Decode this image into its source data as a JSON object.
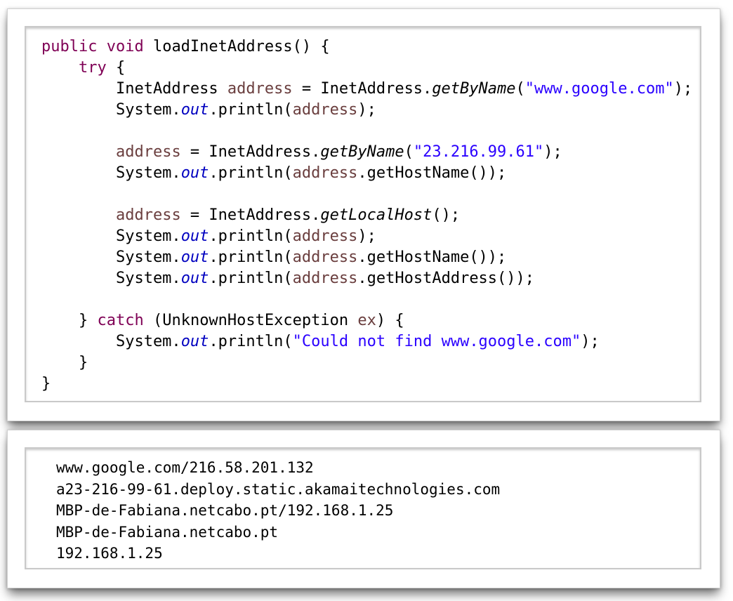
{
  "code_view": {
    "lines": [
      [
        {
          "t": "public void",
          "c": "kw"
        },
        {
          "t": " loadInetAddress() {",
          "c": "plain"
        }
      ],
      [
        {
          "t": "    ",
          "c": "plain"
        },
        {
          "t": "try",
          "c": "kw"
        },
        {
          "t": " {",
          "c": "plain"
        }
      ],
      [
        {
          "t": "        InetAddress ",
          "c": "plain"
        },
        {
          "t": "address",
          "c": "var"
        },
        {
          "t": " = InetAddress.",
          "c": "plain"
        },
        {
          "t": "getByName",
          "c": "static"
        },
        {
          "t": "(",
          "c": "plain"
        },
        {
          "t": "\"www.google.com\"",
          "c": "str"
        },
        {
          "t": ");",
          "c": "plain"
        }
      ],
      [
        {
          "t": "        System.",
          "c": "plain"
        },
        {
          "t": "out",
          "c": "field"
        },
        {
          "t": ".println(",
          "c": "plain"
        },
        {
          "t": "address",
          "c": "var"
        },
        {
          "t": ");",
          "c": "plain"
        }
      ],
      [],
      [
        {
          "t": "        ",
          "c": "plain"
        },
        {
          "t": "address",
          "c": "var"
        },
        {
          "t": " = InetAddress.",
          "c": "plain"
        },
        {
          "t": "getByName",
          "c": "static"
        },
        {
          "t": "(",
          "c": "plain"
        },
        {
          "t": "\"23.216.99.61\"",
          "c": "str"
        },
        {
          "t": ");",
          "c": "plain"
        }
      ],
      [
        {
          "t": "        System.",
          "c": "plain"
        },
        {
          "t": "out",
          "c": "field"
        },
        {
          "t": ".println(",
          "c": "plain"
        },
        {
          "t": "address",
          "c": "var"
        },
        {
          "t": ".getHostName());",
          "c": "plain"
        }
      ],
      [],
      [
        {
          "t": "        ",
          "c": "plain"
        },
        {
          "t": "address",
          "c": "var"
        },
        {
          "t": " = InetAddress.",
          "c": "plain"
        },
        {
          "t": "getLocalHost",
          "c": "static"
        },
        {
          "t": "();",
          "c": "plain"
        }
      ],
      [
        {
          "t": "        System.",
          "c": "plain"
        },
        {
          "t": "out",
          "c": "field"
        },
        {
          "t": ".println(",
          "c": "plain"
        },
        {
          "t": "address",
          "c": "var"
        },
        {
          "t": ");",
          "c": "plain"
        }
      ],
      [
        {
          "t": "        System.",
          "c": "plain"
        },
        {
          "t": "out",
          "c": "field"
        },
        {
          "t": ".println(",
          "c": "plain"
        },
        {
          "t": "address",
          "c": "var"
        },
        {
          "t": ".getHostName());",
          "c": "plain"
        }
      ],
      [
        {
          "t": "        System.",
          "c": "plain"
        },
        {
          "t": "out",
          "c": "field"
        },
        {
          "t": ".println(",
          "c": "plain"
        },
        {
          "t": "address",
          "c": "var"
        },
        {
          "t": ".getHostAddress());",
          "c": "plain"
        }
      ],
      [],
      [
        {
          "t": "    } ",
          "c": "plain"
        },
        {
          "t": "catch",
          "c": "kw"
        },
        {
          "t": " (UnknownHostException ",
          "c": "plain"
        },
        {
          "t": "ex",
          "c": "var"
        },
        {
          "t": ") {",
          "c": "plain"
        }
      ],
      [
        {
          "t": "        System.",
          "c": "plain"
        },
        {
          "t": "out",
          "c": "field"
        },
        {
          "t": ".println(",
          "c": "plain"
        },
        {
          "t": "\"Could not find www.google.com\"",
          "c": "str"
        },
        {
          "t": ");",
          "c": "plain"
        }
      ],
      [
        {
          "t": "    }",
          "c": "plain"
        }
      ],
      [
        {
          "t": "}",
          "c": "plain"
        }
      ]
    ]
  },
  "output_view": {
    "lines": [
      "www.google.com/216.58.201.132",
      "a23-216-99-61.deploy.static.akamaitechnologies.com",
      "MBP-de-Fabiana.netcabo.pt/192.168.1.25",
      "MBP-de-Fabiana.netcabo.pt",
      "192.168.1.25"
    ]
  },
  "colors": {
    "keyword": "#7f0055",
    "variable": "#6a3e3e",
    "string": "#2a00ff",
    "field": "#0000c0",
    "text": "#000000"
  }
}
